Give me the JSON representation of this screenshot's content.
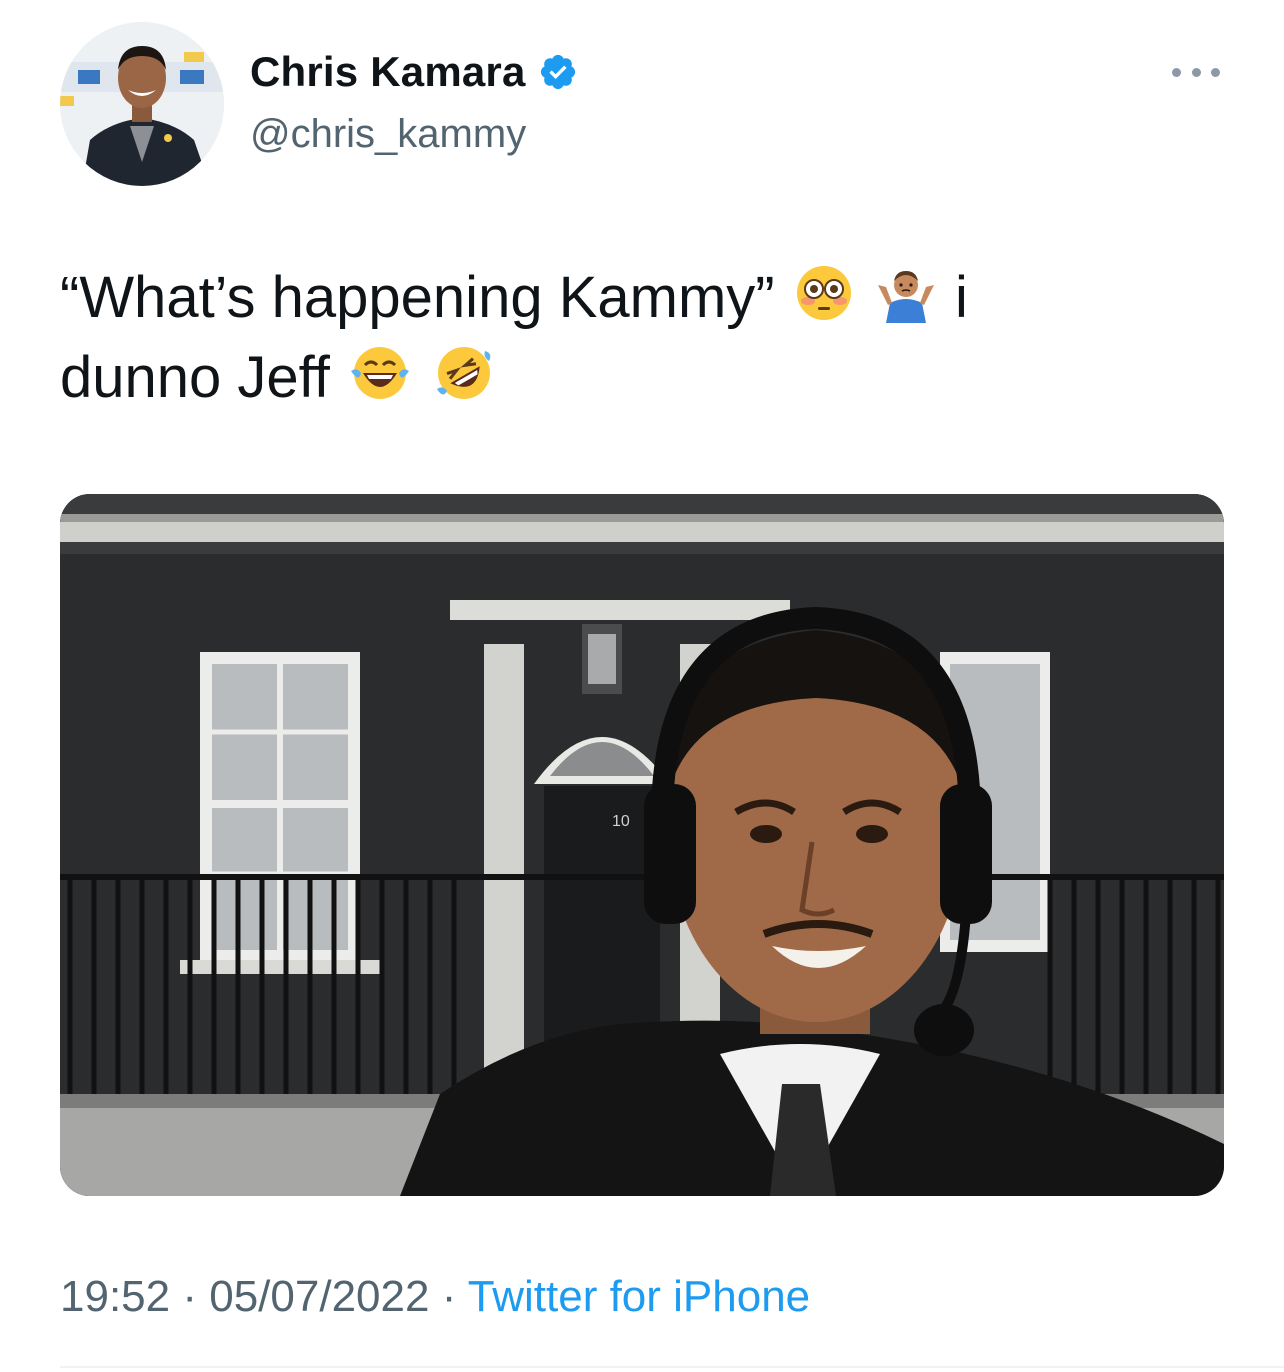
{
  "author": {
    "display_name": "Chris Kamara",
    "handle": "@chris_kammy",
    "verified": true,
    "avatar_icon": "profile-photo"
  },
  "more_icon": "ellipsis-icon",
  "tweet": {
    "text_part1": "“What’s happening Kammy”",
    "text_part2": "i",
    "text_part3": "dunno Jeff",
    "emojis": [
      "flushed-face",
      "person-shrugging",
      "face-with-tears-of-joy",
      "rolling-on-the-floor-laughing"
    ]
  },
  "media": {
    "type": "photo",
    "door_number": "10"
  },
  "meta": {
    "time": "19:52",
    "separator": "·",
    "date": "05/07/2022",
    "source": "Twitter for iPhone"
  },
  "colors": {
    "verified_blue": "#1d9bf0",
    "link_blue": "#1d9bf0",
    "secondary_text": "#536471",
    "primary_text": "#0f1419"
  }
}
